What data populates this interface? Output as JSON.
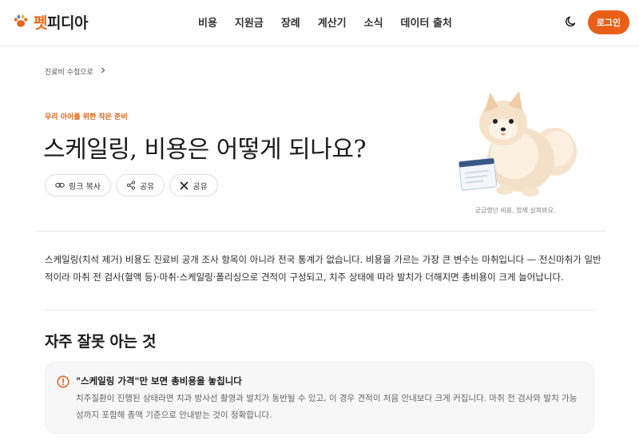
{
  "header": {
    "logo_brand_accent": "펫",
    "logo_brand_rest": "피디아",
    "nav": [
      "비용",
      "지원금",
      "장례",
      "계산기",
      "소식",
      "데이터 출처"
    ],
    "login_label": "로그인",
    "theme_icon": "moon-icon",
    "logo_icon": "paw-icon"
  },
  "breadcrumb": {
    "label": "진료비 수첩으로"
  },
  "hero": {
    "eyebrow": "우리 아이를 위한 작은 준비",
    "title": "스케일링, 비용은 어떻게 되나요?",
    "share": {
      "copy_link": "링크 복사",
      "share": "공유",
      "x_share": "공유"
    },
    "illustration_caption": "궁금했던 비용, 함께 살펴봐요."
  },
  "intro": "스케일링(치석 제거) 비용도 진료비 공개 조사 항목이 아니라 전국 통계가 없습니다. 비용을 가르는 가장 큰 변수는 마취입니다 — 전신마취가 일반적이라 마취 전 검사(혈액 등)·마취·스케일링·폴리싱으로 견적이 구성되고, 치주 상태에 따라 발치가 더해지면 총비용이 크게 늘어납니다.",
  "misconceptions": {
    "title": "자주 잘못 아는 것",
    "items": [
      {
        "title": "\"스케일링 가격\"만 보면 총비용을 놓칩니다",
        "body": "치주질환이 진행된 상태라면 치과 방사선 촬영과 발치가 동반될 수 있고, 이 경우 견적이 처음 안내보다 크게 커집니다. 마취 전 검사와 발치 가능성까지 포함해 총액 기준으로 안내받는 것이 정확합니다."
      }
    ]
  },
  "colors": {
    "accent": "#ea5f17",
    "eyebrow": "#e0631a",
    "card_bg": "#f7f7f7"
  }
}
